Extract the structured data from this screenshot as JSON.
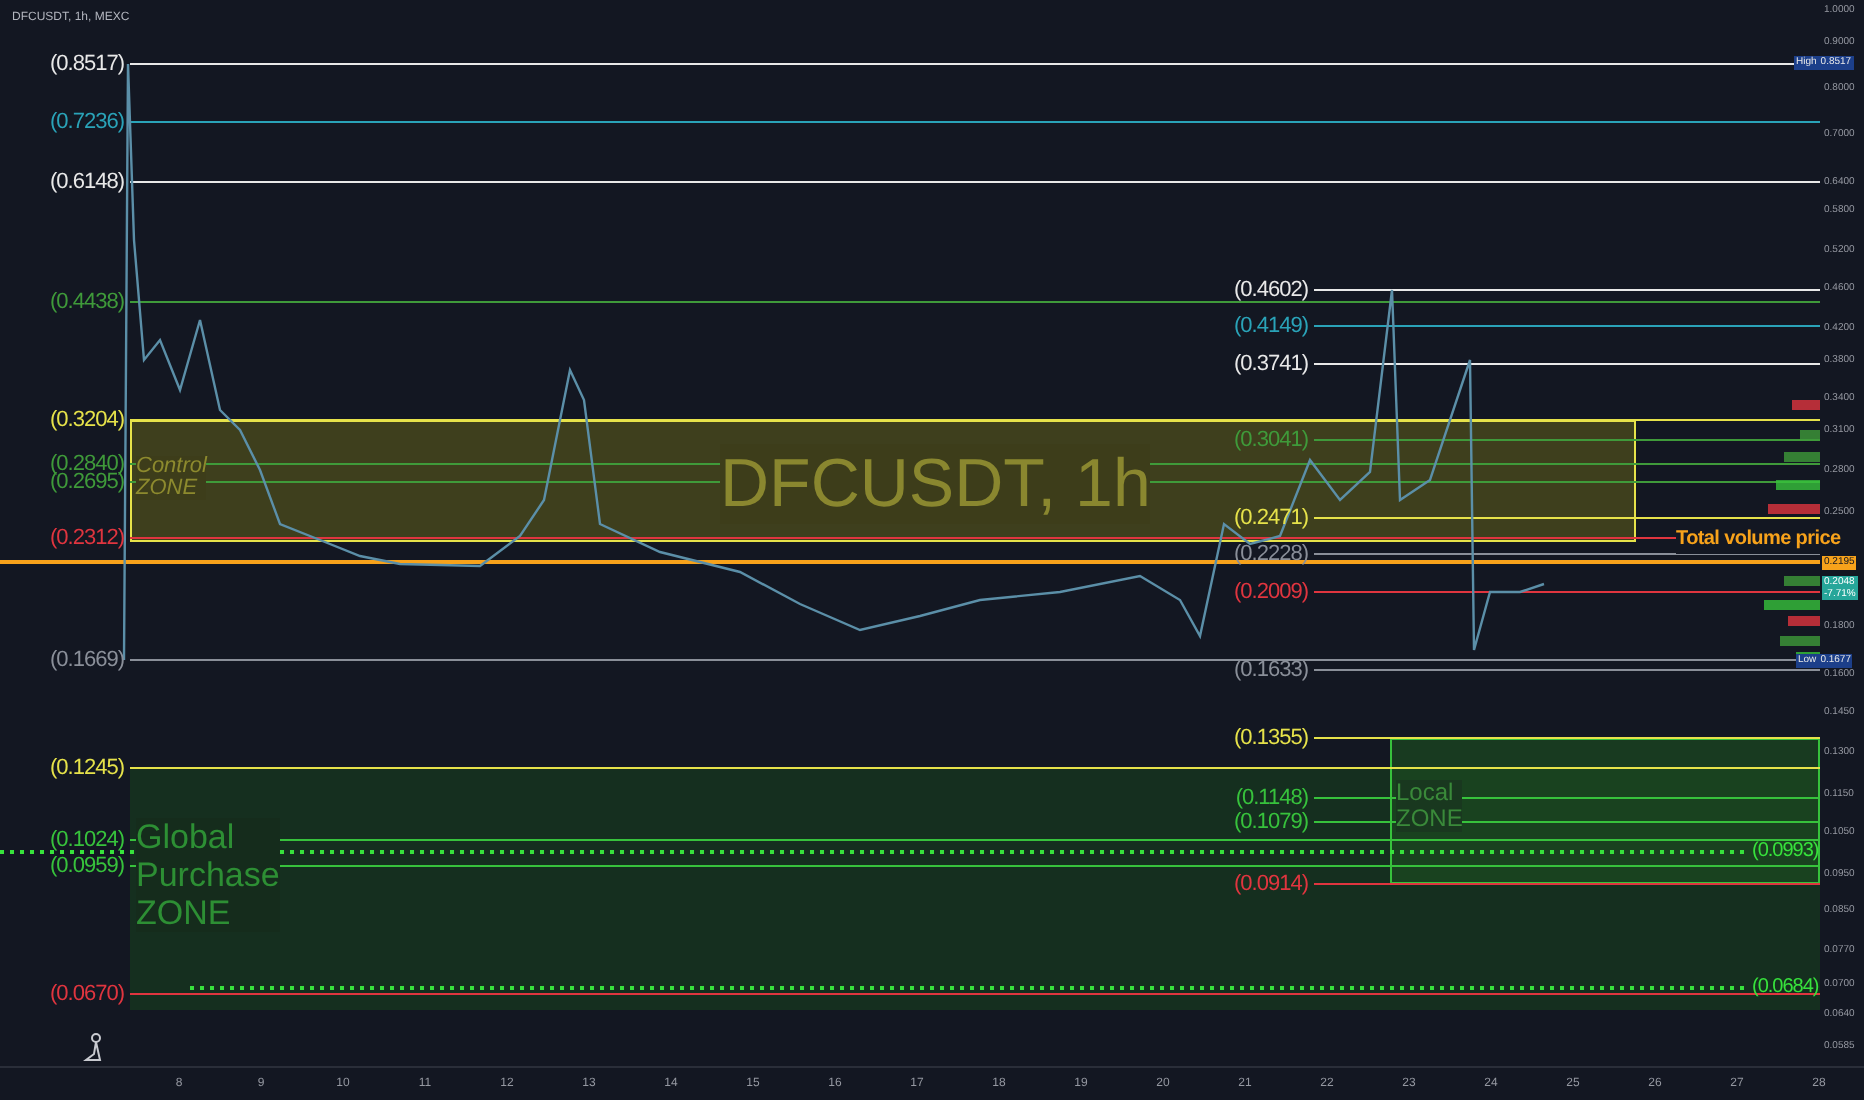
{
  "chart_header": {
    "symbol": "DFCUSDT, 1h, MEXC"
  },
  "watermark": "DFCUSDT, 1h",
  "levels_left": [
    {
      "label": "(0.8517)",
      "color": "#e8e8e8"
    },
    {
      "label": "(0.7236)",
      "color": "#2aa3b8"
    },
    {
      "label": "(0.6148)",
      "color": "#e8e8e8"
    },
    {
      "label": "(0.4438)",
      "color": "#3f9a3a"
    },
    {
      "label": "(0.3204)",
      "color": "#e6e24a"
    },
    {
      "label": "(0.2840)",
      "color": "#3f9a3a"
    },
    {
      "label": "(0.2695)",
      "color": "#3f9a3a"
    },
    {
      "label": "(0.2312)",
      "color": "#e0353f"
    },
    {
      "label": "(0.1669)",
      "color": "#8a8f99"
    },
    {
      "label": "(0.1245)",
      "color": "#e6e24a"
    },
    {
      "label": "(0.1024)",
      "color": "#37c23c"
    },
    {
      "label": "(0.0959)",
      "color": "#37c23c"
    },
    {
      "label": "(0.0670)",
      "color": "#e0353f"
    }
  ],
  "levels_right": [
    {
      "label": "(0.4602)",
      "color": "#e8e8e8"
    },
    {
      "label": "(0.4149)",
      "color": "#2aa3b8"
    },
    {
      "label": "(0.3741)",
      "color": "#e8e8e8"
    },
    {
      "label": "(0.3041)",
      "color": "#3f9a3a"
    },
    {
      "label": "(0.2471)",
      "color": "#e6e24a"
    },
    {
      "label": "(0.2228)",
      "color": "#8a8f99"
    },
    {
      "label": "(0.2009)",
      "color": "#e0353f"
    },
    {
      "label": "(0.1633)",
      "color": "#8a8f99"
    },
    {
      "label": "(0.1355)",
      "color": "#e6e24a"
    },
    {
      "label": "(0.1148)",
      "color": "#37c23c"
    },
    {
      "label": "(0.1079)",
      "color": "#37c23c"
    },
    {
      "label": "(0.0914)",
      "color": "#e0353f"
    }
  ],
  "dotted_levels": [
    {
      "label": "(0.0993)"
    },
    {
      "label": "(0.0684)"
    }
  ],
  "zones": [
    {
      "kind": "control",
      "label": "Control\nZONE"
    },
    {
      "kind": "global",
      "label": "Global\nPurchase\nZONE"
    },
    {
      "kind": "local",
      "label": "Local\nZONE"
    }
  ],
  "total_volume_label": "Total volume price",
  "price_axis": {
    "ticks": [
      "1.0000",
      "0.9000",
      "0.8000",
      "0.7000",
      "0.6400",
      "0.5800",
      "0.5200",
      "0.4600",
      "0.4200",
      "0.3800",
      "0.3400",
      "0.3100",
      "0.2800",
      "0.2500",
      "0.1800",
      "0.1600",
      "0.1450",
      "0.1300",
      "0.1150",
      "0.1050",
      "0.0950",
      "0.0850",
      "0.0770",
      "0.0700",
      "0.0640",
      "0.0585"
    ],
    "high_tag": {
      "label": "High",
      "value": "0.8517"
    },
    "low_tag": {
      "label": "Low",
      "value": "0.1677"
    },
    "current_price": "0.2195",
    "last_price": "0.2048",
    "change": "-7.71%"
  },
  "time_axis": {
    "ticks": [
      "8",
      "9",
      "10",
      "11",
      "12",
      "13",
      "14",
      "15",
      "16",
      "17",
      "18",
      "19",
      "20",
      "21",
      "22",
      "23",
      "24",
      "25",
      "26",
      "27",
      "28"
    ]
  }
}
